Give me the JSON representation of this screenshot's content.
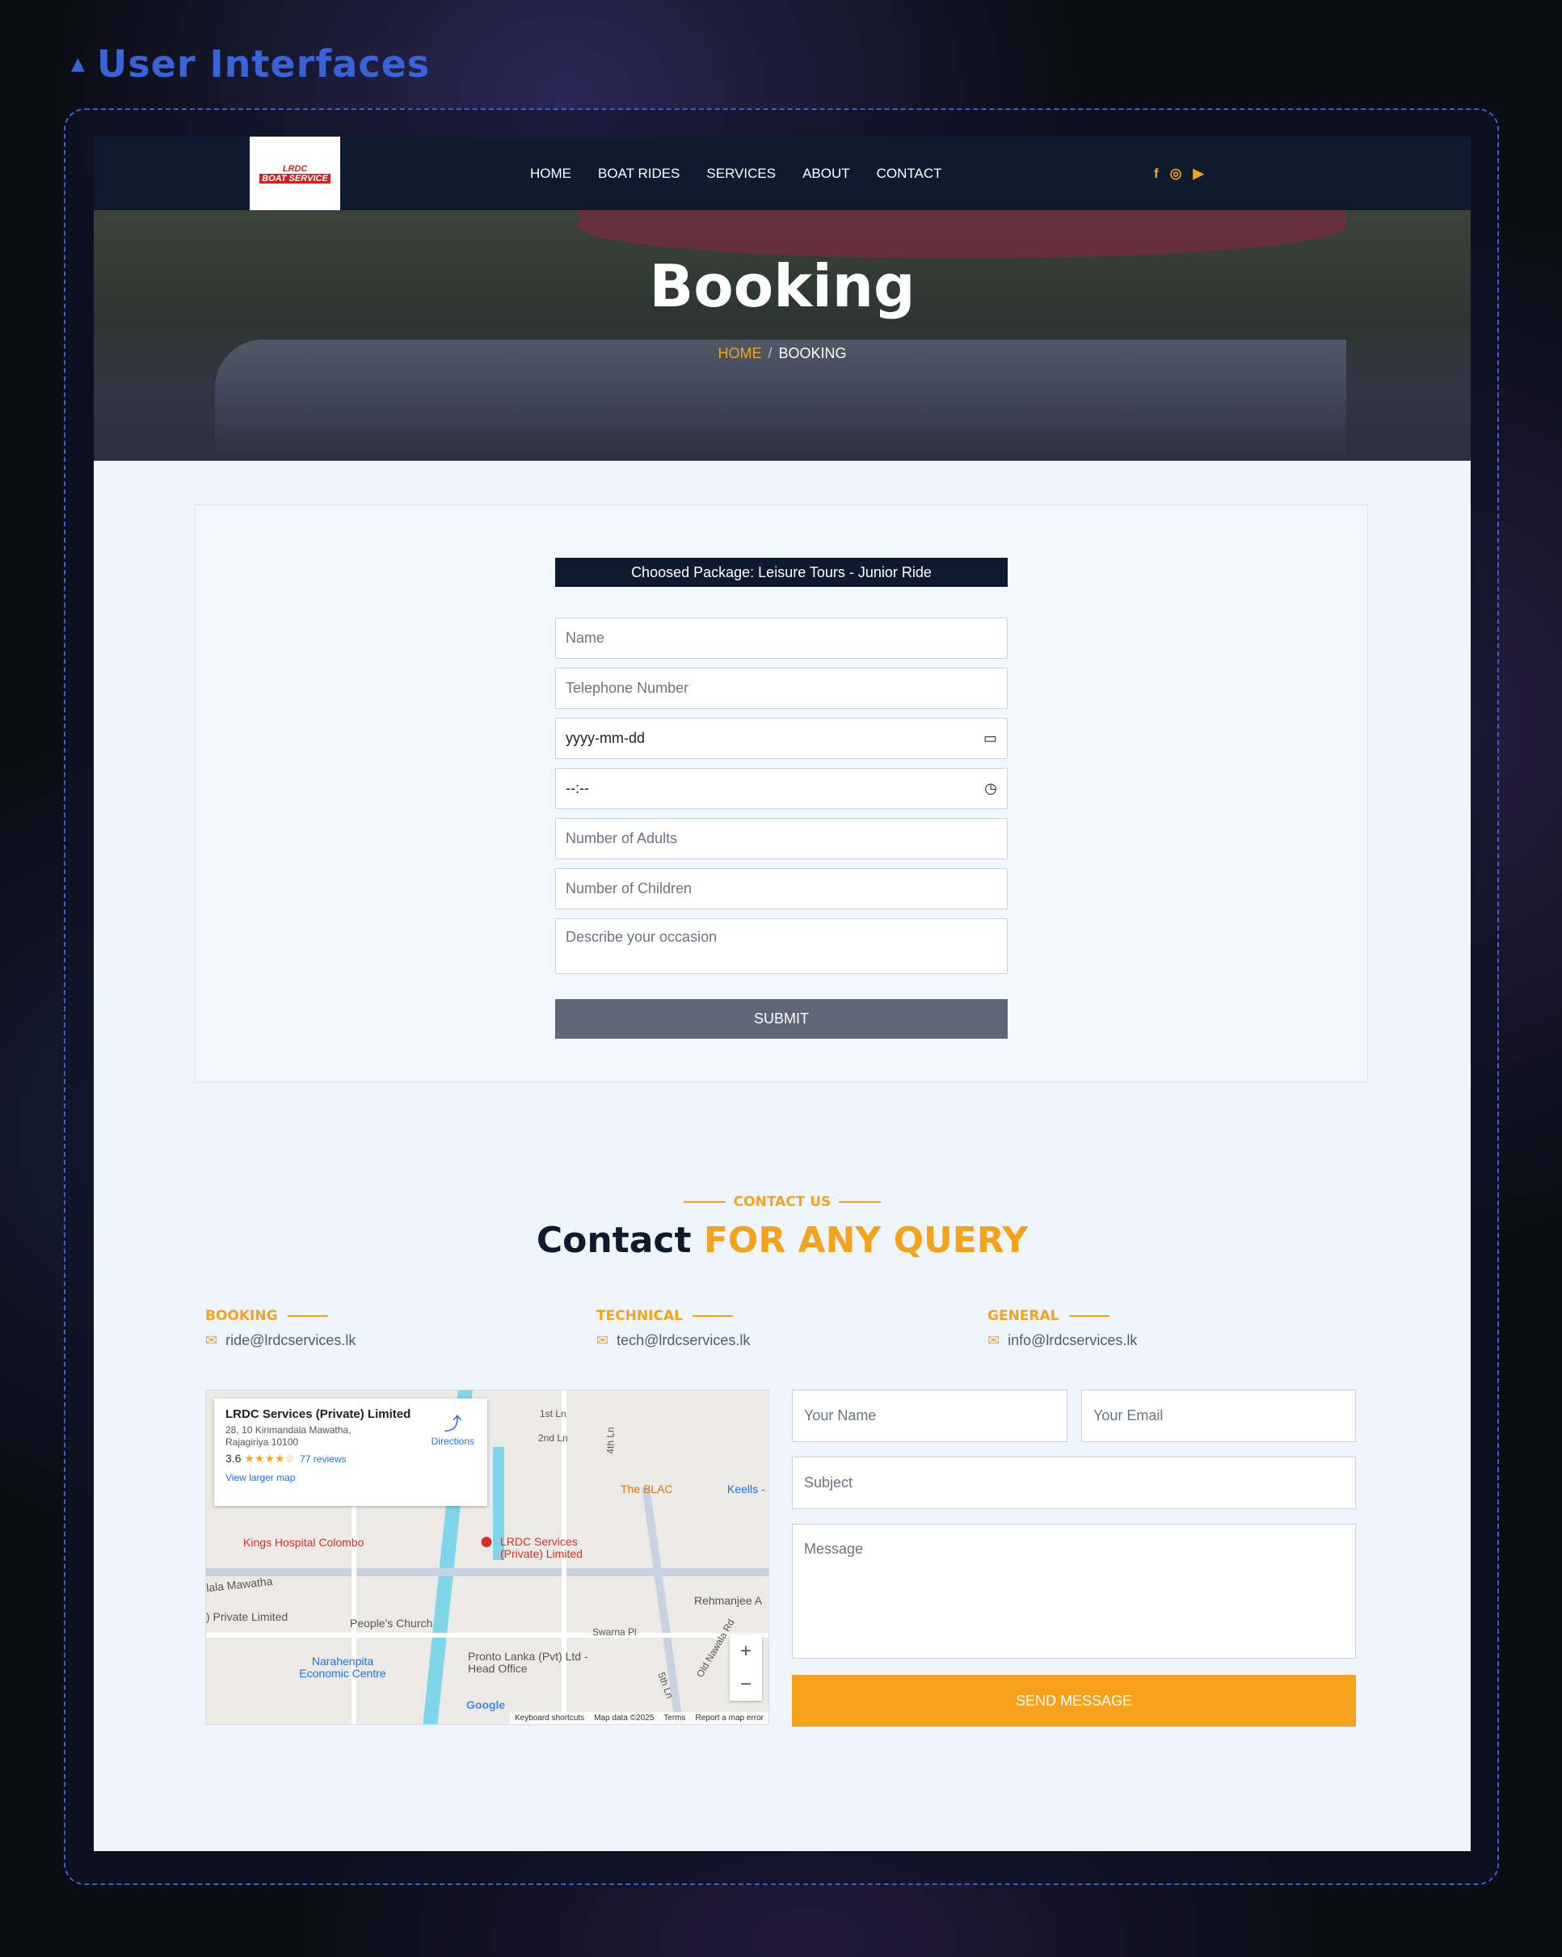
{
  "section": {
    "title": "User Interfaces"
  },
  "logo": {
    "line1": "LRDC",
    "line2": "BOAT SERVICE"
  },
  "nav": {
    "items": [
      "HOME",
      "BOAT RIDES",
      "SERVICES",
      "ABOUT",
      "CONTACT"
    ]
  },
  "social": {
    "icons": [
      "facebook-icon",
      "instagram-icon",
      "youtube-icon"
    ]
  },
  "hero": {
    "title": "Booking",
    "crumb_home": "HOME",
    "crumb_sep": "/",
    "crumb_current": "BOOKING"
  },
  "booking": {
    "package": "Choosed Package: Leisure Tours - Junior Ride",
    "name_placeholder": "Name",
    "phone_placeholder": "Telephone Number",
    "date_placeholder": "yyyy-mm-dd",
    "time_placeholder": "--:--",
    "adults_placeholder": "Number of Adults",
    "children_placeholder": "Number of Children",
    "occasion_placeholder": "Describe your occasion",
    "submit_label": "SUBMIT"
  },
  "contact": {
    "kicker": "CONTACT US",
    "title_main": "Contact",
    "title_highlight": "FOR ANY QUERY",
    "columns": [
      {
        "label": "BOOKING",
        "email": "ride@lrdcservices.lk"
      },
      {
        "label": "TECHNICAL",
        "email": "tech@lrdcservices.lk"
      },
      {
        "label": "GENERAL",
        "email": "info@lrdcservices.lk"
      }
    ],
    "form": {
      "name_placeholder": "Your Name",
      "email_placeholder": "Your Email",
      "subject_placeholder": "Subject",
      "message_placeholder": "Message",
      "send_label": "SEND MESSAGE"
    }
  },
  "map": {
    "place_name": "LRDC Services (Private) Limited",
    "address": "28, 10 Kirimandala Mawatha, Rajagiriya 10100",
    "rating": "3.6",
    "reviews": "77 reviews",
    "view_larger": "View larger map",
    "directions": "Directions",
    "labels": {
      "hospital": "Kings Hospital Colombo",
      "pin": "LRDC Services (Private) Limited",
      "road": "lala Mawatha",
      "private": ") Private Limited",
      "church": "People's Church",
      "pronto": "Pronto Lanka (Pvt) Ltd - Head Office",
      "narahenpita": "Narahenpita Economic Centre",
      "blac": "The BLAC",
      "keells": "Keells -",
      "rehmanjee": "Rehmanjee A",
      "swarna": "Swarna Pl",
      "lane1": "1st Ln",
      "lane2": "2nd Ln",
      "lane4": "4th Ln",
      "lane5": "5th Ln",
      "oldnawala": "Old Nawala Rd",
      "google": "Google"
    },
    "footer": [
      "Keyboard shortcuts",
      "Map data ©2025",
      "Terms",
      "Report a map error"
    ]
  },
  "colors": {
    "accent": "#f7a21b",
    "navy": "#0e1a2e",
    "section_title": "#3a63d9"
  }
}
